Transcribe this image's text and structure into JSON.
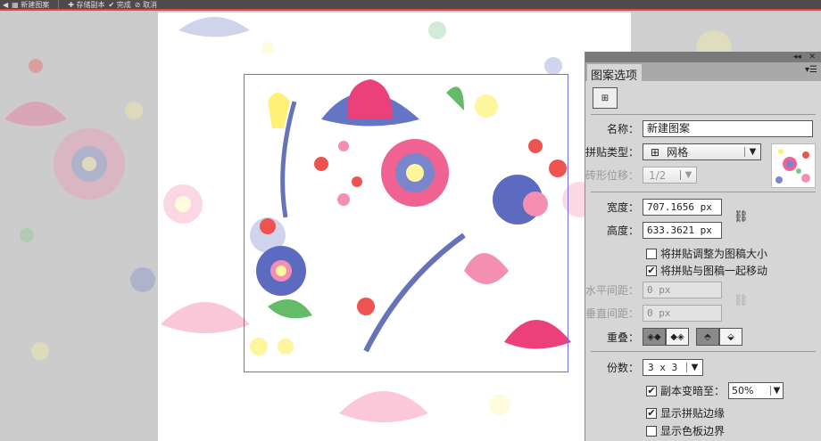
{
  "toolbar": {
    "back_icon": "arrow-left-icon",
    "new_pattern": "新建图案",
    "save_copy": "存储副本",
    "done": "完成",
    "cancel": "取消"
  },
  "panel": {
    "title": "图案选项",
    "name_label": "名称：",
    "name_value": "新建图案",
    "tile_type_label": "拼贴类型：",
    "tile_type_value": "网格",
    "brick_offset_label": "砖形位移：",
    "brick_offset_value": "1/2",
    "width_label": "宽度：",
    "width_value": "707.1656 px",
    "height_label": "高度：",
    "height_value": "633.3621 px",
    "size_tile_to_art": "将拼贴调整为图稿大小",
    "size_tile_checked": false,
    "move_tile_with_art": "将拼贴与图稿一起移动",
    "move_tile_checked": true,
    "h_spacing_label": "水平间距：",
    "h_spacing_value": "0 px",
    "v_spacing_label": "垂直间距：",
    "v_spacing_value": "0 px",
    "overlap_label": "重叠：",
    "copies_label": "份数：",
    "copies_value": "3 x 3",
    "dim_copies_label": "副本变暗至：",
    "dim_copies_checked": true,
    "dim_value": "50%",
    "show_tile_edge": "显示拼贴边缘",
    "show_tile_edge_checked": true,
    "show_swatch_bounds": "显示色板边界",
    "show_swatch_bounds_checked": false
  }
}
